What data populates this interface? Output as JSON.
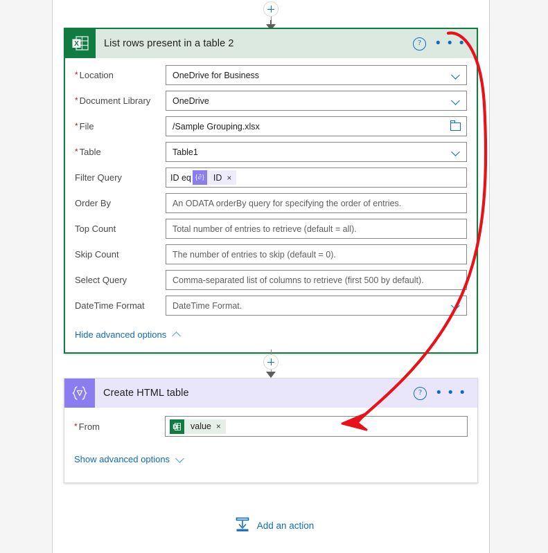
{
  "connectors": {
    "top_plus": "add-step",
    "middle_plus": "add-step"
  },
  "cards": [
    {
      "id": "list-rows",
      "icon": "excel-table-icon",
      "title": "List rows present in a table 2",
      "accent": "#107c41",
      "header_bg": "#dbe9e0",
      "help_label": "?",
      "menu_label": "• • •",
      "fields": [
        {
          "label": "Location",
          "required": true,
          "value": "OneDrive for Business",
          "placeholder": "",
          "control": "dropdown"
        },
        {
          "label": "Document Library",
          "required": true,
          "value": "OneDrive",
          "placeholder": "",
          "control": "dropdown"
        },
        {
          "label": "File",
          "required": true,
          "value": "/Sample Grouping.xlsx",
          "placeholder": "",
          "control": "folder"
        },
        {
          "label": "Table",
          "required": true,
          "value": "Table1",
          "placeholder": "",
          "control": "dropdown"
        },
        {
          "label": "Filter Query",
          "required": false,
          "value": "",
          "placeholder": "",
          "control": "token",
          "token": {
            "pretext": "ID eq",
            "icon": "expression-icon",
            "icon_glyph": "{∂}",
            "chip_text": "ID",
            "remove_label": "×",
            "style": "expr"
          }
        },
        {
          "label": "Order By",
          "required": false,
          "value": "",
          "placeholder": "An ODATA orderBy query for specifying the order of entries.",
          "control": "text"
        },
        {
          "label": "Top Count",
          "required": false,
          "value": "",
          "placeholder": "Total number of entries to retrieve (default = all).",
          "control": "text"
        },
        {
          "label": "Skip Count",
          "required": false,
          "value": "",
          "placeholder": "The number of entries to skip (default = 0).",
          "control": "text"
        },
        {
          "label": "Select Query",
          "required": false,
          "value": "",
          "placeholder": "Comma-separated list of columns to retrieve (first 500 by default).",
          "control": "text"
        },
        {
          "label": "DateTime Format",
          "required": false,
          "value": "",
          "placeholder": "DateTime Format.",
          "control": "dropdown"
        }
      ],
      "advanced_label": "Hide advanced options",
      "advanced_state": "expanded"
    },
    {
      "id": "create-html-table",
      "icon": "expression-braces-icon",
      "icon_glyph": "{∇}",
      "title": "Create HTML table",
      "accent": "#8b7cf0",
      "header_bg": "#e9e6fb",
      "help_label": "?",
      "menu_label": "• • •",
      "fields": [
        {
          "label": "From",
          "required": true,
          "value": "",
          "placeholder": "",
          "control": "token",
          "token": {
            "pretext": "",
            "icon": "excel-icon",
            "icon_glyph": "⌗",
            "chip_text": "value",
            "remove_label": "×",
            "style": "xl"
          }
        }
      ],
      "advanced_label": "Show advanced options",
      "advanced_state": "collapsed"
    }
  ],
  "add_action": {
    "label": "Add an action",
    "icon": "add-action-arrow-icon",
    "color": "#0f6cbd"
  },
  "annotation": {
    "type": "hand-drawn-arrow",
    "color": "#e8121a",
    "description": "red curved arrow from list rows header to Create HTML table From field"
  }
}
